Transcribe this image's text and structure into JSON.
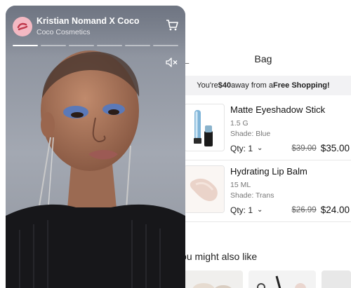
{
  "bag": {
    "title": "Bag",
    "back_icon": "arrow-left-icon",
    "promo": {
      "prefix": "You're ",
      "amount": "$40",
      "middle": " away from a ",
      "highlight": "Free Shopping!"
    },
    "items": [
      {
        "name": "Matte Eyeshadow Stick",
        "size": "1.5 G",
        "shade": "Shade: Blue",
        "qty": "Qty: 1",
        "old_price": "$39.00",
        "price": "$35.00"
      },
      {
        "name": "Hydrating Lip Balm",
        "size": "15 ML",
        "shade": "Shade: Trans",
        "qty": "Qty: 1",
        "old_price": "$26.99",
        "price": "$24.00"
      }
    ],
    "recommend_title": "You might also like"
  },
  "story": {
    "title": "Kristian Nomand X Coco",
    "subtitle": "Coco Cosmetics",
    "segments": 6,
    "active_segment": 1,
    "icons": {
      "avatar": "brand-logo-icon",
      "cart": "shopping-cart-icon",
      "mute": "muted-speaker-icon"
    },
    "colors": {
      "avatar_bg": "#f4b9c3",
      "logo": "#c0394b"
    }
  }
}
